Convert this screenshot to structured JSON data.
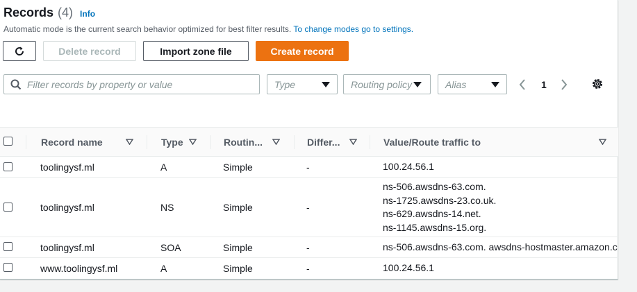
{
  "header": {
    "title": "Records",
    "count": "(4)",
    "info_label": "Info",
    "description": "Automatic mode is the current search behavior optimized for best filter results.",
    "description_link": "To change modes go to settings."
  },
  "toolbar": {
    "refresh_icon": "refresh-icon",
    "delete_label": "Delete record",
    "import_label": "Import zone file",
    "create_label": "Create record"
  },
  "filters": {
    "search_placeholder": "Filter records by property or value",
    "type_placeholder": "Type",
    "routing_placeholder": "Routing policy",
    "alias_placeholder": "Alias"
  },
  "pagination": {
    "current_page": "1"
  },
  "colors": {
    "accent": "#ec7211",
    "link": "#0073bb"
  },
  "table": {
    "columns": [
      {
        "label": "Record name"
      },
      {
        "label": "Type"
      },
      {
        "label": "Routin..."
      },
      {
        "label": "Differ..."
      },
      {
        "label": "Value/Route traffic to"
      }
    ],
    "rows": [
      {
        "name": "toolingysf.ml",
        "type": "A",
        "routing": "Simple",
        "differ": "-",
        "values": [
          "100.24.56.1"
        ]
      },
      {
        "name": "toolingysf.ml",
        "type": "NS",
        "routing": "Simple",
        "differ": "-",
        "values": [
          "ns-506.awsdns-63.com.",
          "ns-1725.awsdns-23.co.uk.",
          "ns-629.awsdns-14.net.",
          "ns-1145.awsdns-15.org."
        ]
      },
      {
        "name": "toolingysf.ml",
        "type": "SOA",
        "routing": "Simple",
        "differ": "-",
        "values": [
          "ns-506.awsdns-63.com. awsdns-hostmaster.amazon.c"
        ]
      },
      {
        "name": "www.toolingysf.ml",
        "type": "A",
        "routing": "Simple",
        "differ": "-",
        "values": [
          "100.24.56.1"
        ]
      }
    ]
  }
}
